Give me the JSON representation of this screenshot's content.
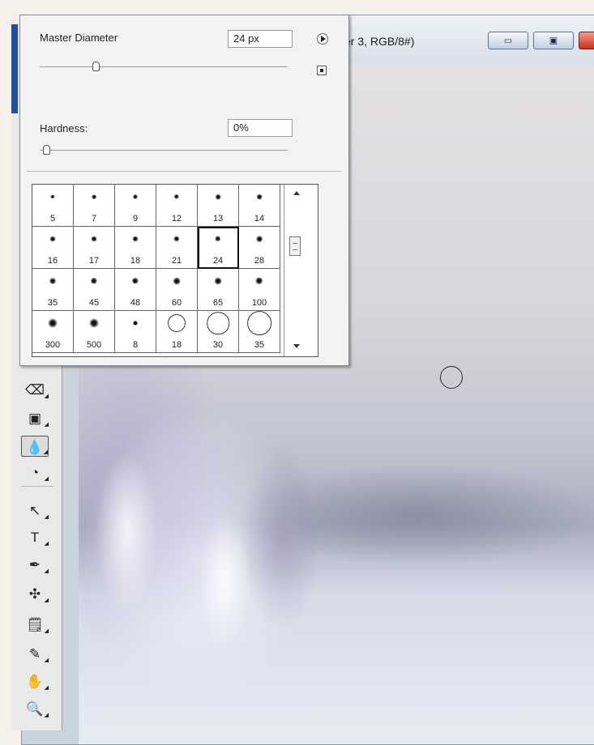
{
  "window": {
    "title_partial": "er 3, RGB/8#)",
    "minimize_icon": "minimize-icon",
    "maximize_icon": "maximize-icon",
    "close_icon": "close-icon"
  },
  "brush_picker": {
    "master_diameter_label": "Master Diameter",
    "master_diameter_value": "24 px",
    "master_diameter_fraction": 0.12,
    "hardness_label": "Hardness:",
    "hardness_value": "0%",
    "hardness_fraction": 0.0,
    "menu_icon": "flyout-menu-icon",
    "save_icon": "new-preset-icon",
    "presets": [
      {
        "size": "5",
        "kind": "soft"
      },
      {
        "size": "7",
        "kind": "soft"
      },
      {
        "size": "9",
        "kind": "soft"
      },
      {
        "size": "12",
        "kind": "soft"
      },
      {
        "size": "13",
        "kind": "soft"
      },
      {
        "size": "14",
        "kind": "soft"
      },
      {
        "size": "16",
        "kind": "soft"
      },
      {
        "size": "17",
        "kind": "soft"
      },
      {
        "size": "18",
        "kind": "soft"
      },
      {
        "size": "21",
        "kind": "soft"
      },
      {
        "size": "24",
        "kind": "soft",
        "selected": true
      },
      {
        "size": "28",
        "kind": "soft"
      },
      {
        "size": "35",
        "kind": "soft"
      },
      {
        "size": "45",
        "kind": "soft"
      },
      {
        "size": "48",
        "kind": "soft"
      },
      {
        "size": "60",
        "kind": "soft"
      },
      {
        "size": "65",
        "kind": "soft"
      },
      {
        "size": "100",
        "kind": "soft"
      },
      {
        "size": "300",
        "kind": "soft"
      },
      {
        "size": "500",
        "kind": "soft"
      },
      {
        "size": "8",
        "kind": "hard"
      },
      {
        "size": "18",
        "kind": "ring"
      },
      {
        "size": "30",
        "kind": "ring"
      },
      {
        "size": "35",
        "kind": "ring"
      }
    ]
  },
  "toolbox": {
    "tools": [
      {
        "name": "eraser-tool",
        "icon": "eraser-icon",
        "glyph": "⌫"
      },
      {
        "name": "gradient-tool",
        "icon": "gradient-icon",
        "glyph": "▣"
      },
      {
        "name": "blur-tool",
        "icon": "water-drop-icon",
        "glyph": "💧",
        "selected": true
      },
      {
        "name": "dodge-tool",
        "icon": "dodge-icon",
        "glyph": "◔"
      },
      {
        "name": "path-selection-tool",
        "icon": "arrow-pointer-icon",
        "glyph": "↖"
      },
      {
        "name": "type-tool",
        "icon": "type-icon",
        "glyph": "T"
      },
      {
        "name": "pen-tool",
        "icon": "pen-icon",
        "glyph": "✒"
      },
      {
        "name": "custom-shape-tool",
        "icon": "shape-icon",
        "glyph": "✣"
      },
      {
        "name": "notes-tool",
        "icon": "note-icon",
        "glyph": "🗒"
      },
      {
        "name": "eyedropper-tool",
        "icon": "eyedropper-icon",
        "glyph": "✎"
      },
      {
        "name": "hand-tool",
        "icon": "hand-icon",
        "glyph": "✋"
      },
      {
        "name": "zoom-tool",
        "icon": "magnifier-icon",
        "glyph": "🔍"
      }
    ]
  }
}
